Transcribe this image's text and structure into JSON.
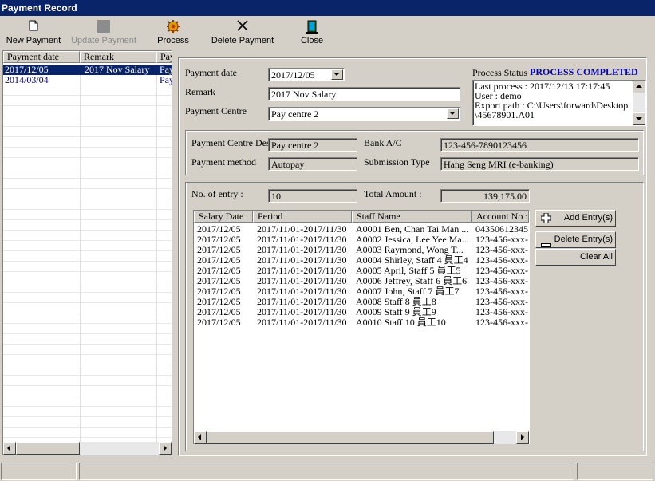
{
  "window": {
    "title": "Payment Record"
  },
  "toolbar": {
    "new_payment": "New Payment",
    "update_payment": "Update Payment",
    "process": "Process",
    "delete_payment": "Delete Payment",
    "close": "Close"
  },
  "payment_list": {
    "columns": [
      "Payment date",
      "Remark",
      "Pay"
    ],
    "rows": [
      {
        "date": "2017/12/05",
        "remark": "2017 Nov Salary",
        "pay": "Pay",
        "selected": true
      },
      {
        "date": "2014/03/04",
        "remark": "",
        "pay": "Pay",
        "selected": false
      }
    ]
  },
  "form": {
    "payment_date_label": "Payment date",
    "payment_date_value": "2017/12/05",
    "remark_label": "Remark",
    "remark_value": "2017 Nov Salary",
    "payment_centre_label": "Payment Centre",
    "payment_centre_value": "Pay centre 2",
    "process_status_label": "Process Status",
    "process_status_value": "PROCESS COMPLETED",
    "process_log": [
      "Last process : 2017/12/13 17:17:45",
      "User : demo",
      "Export path : C:\\Users\\forward\\Desktop",
      "\\45678901.A01"
    ]
  },
  "centre_info": {
    "desc_label": "Payment Centre Desc",
    "desc_value": "Pay centre 2",
    "method_label": "Payment method",
    "method_value": "Autopay",
    "bank_label": "Bank A/C",
    "bank_value": "123-456-7890123456",
    "submission_label": "Submission Type",
    "submission_value": "Hang Seng MRI (e-banking)"
  },
  "summary": {
    "entries_label": "No. of entry :",
    "entries_value": "10",
    "total_label": "Total Amount :",
    "total_value": "139,175.00"
  },
  "entries": {
    "columns": [
      "Salary Date",
      "Period",
      "Staff Name",
      "Account No :"
    ],
    "rows": [
      [
        "2017/12/05",
        "2017/11/01-2017/11/30",
        "A0001 Ben, Chan Tai Man ...",
        "04350612345"
      ],
      [
        "2017/12/05",
        "2017/11/01-2017/11/30",
        "A0002 Jessica, Lee Yee Ma...",
        "123-456-xxx-"
      ],
      [
        "2017/12/05",
        "2017/11/01-2017/11/30",
        "A0003 Raymond, Wong T...",
        "123-456-xxx-"
      ],
      [
        "2017/12/05",
        "2017/11/01-2017/11/30",
        "A0004 Shirley, Staff 4 員工4",
        "123-456-xxx-"
      ],
      [
        "2017/12/05",
        "2017/11/01-2017/11/30",
        "A0005 April, Staff 5 員工5",
        "123-456-xxx-"
      ],
      [
        "2017/12/05",
        "2017/11/01-2017/11/30",
        "A0006 Jeffrey, Staff 6 員工6",
        "123-456-xxx-"
      ],
      [
        "2017/12/05",
        "2017/11/01-2017/11/30",
        "A0007 John, Staff 7 員工7",
        "123-456-xxx-"
      ],
      [
        "2017/12/05",
        "2017/11/01-2017/11/30",
        "A0008 Staff 8 員工8",
        "123-456-xxx-"
      ],
      [
        "2017/12/05",
        "2017/11/01-2017/11/30",
        "A0009 Staff 9 員工9",
        "123-456-xxx-"
      ],
      [
        "2017/12/05",
        "2017/11/01-2017/11/30",
        "A0010 Staff 10 員工10",
        "123-456-xxx-"
      ]
    ]
  },
  "buttons": {
    "add_entry": "Add Entry(s)",
    "delete_entry": "Delete Entry(s)",
    "clear_all": "Clear All"
  },
  "colors": {
    "title_bar": "#0a246a",
    "selection": "#0a246a",
    "status_blue": "#0000cc",
    "list_text_blue": "#000080"
  }
}
